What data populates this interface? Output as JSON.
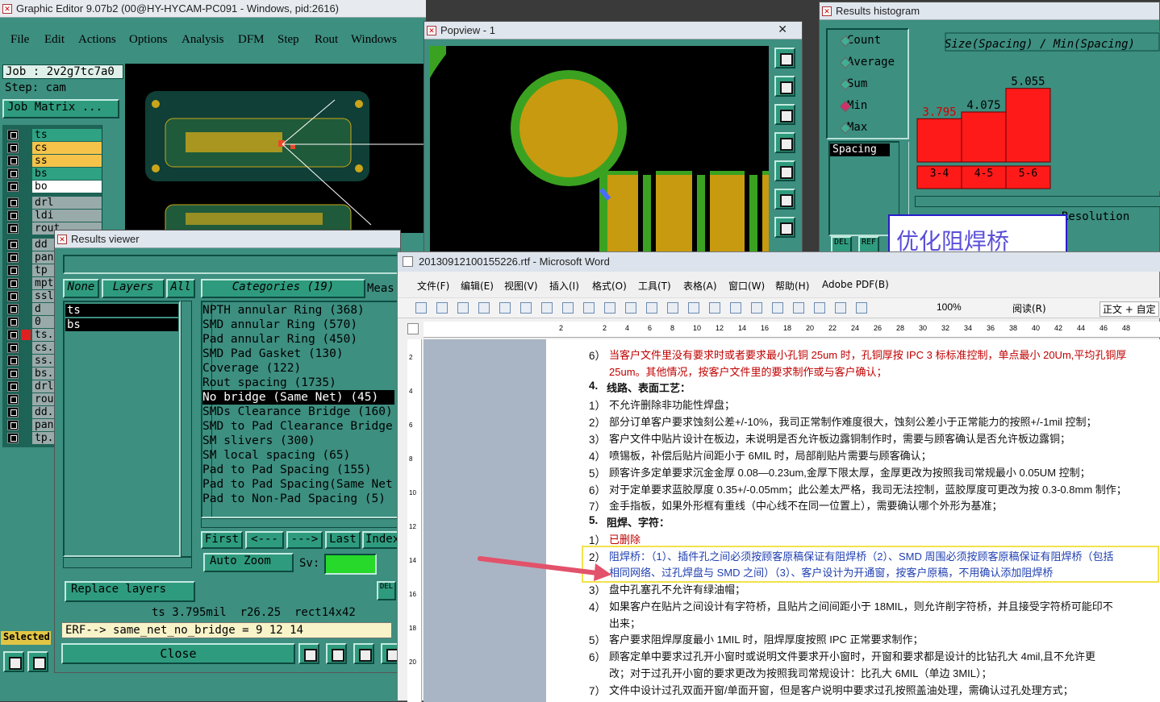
{
  "editor": {
    "title": "Graphic Editor 9.07b2 (00@HY-HYCAM-PC091 - Windows, pid:2616)",
    "menu": [
      "File",
      "Edit",
      "Actions",
      "Options",
      "Analysis",
      "DFM",
      "Step",
      "Rout",
      "Windows"
    ],
    "menu_tail": "p",
    "job": "Job : 2v2g7tc7a0",
    "step": "Step: cam",
    "job_matrix": "Job Matrix ...",
    "layers": [
      {
        "name": "ts",
        "color": "#2fa283"
      },
      {
        "name": "cs",
        "color": "#f5c34a"
      },
      {
        "name": "ss",
        "color": "#f5c34a"
      },
      {
        "name": "bs",
        "color": "#2fa283"
      },
      {
        "name": "bo",
        "color": "#ffffff"
      },
      {
        "name": "drl",
        "color": "#9aa"
      },
      {
        "name": "ldi",
        "color": "#9aa"
      },
      {
        "name": "rout",
        "color": "#9aa"
      },
      {
        "name": "dd",
        "color": "#9aa"
      },
      {
        "name": "pane",
        "color": "#9aa"
      },
      {
        "name": "tp",
        "color": "#9aa"
      },
      {
        "name": "mpth",
        "color": "#9aa"
      },
      {
        "name": "ssls",
        "color": "#9aa"
      },
      {
        "name": "d",
        "color": "#9aa"
      },
      {
        "name": "0",
        "color": "#9aa"
      },
      {
        "name": "ts.c",
        "color": "#9aa"
      },
      {
        "name": "cs.c",
        "color": "#9aa"
      },
      {
        "name": "ss.c",
        "color": "#9aa"
      },
      {
        "name": "bs.c",
        "color": "#9aa"
      },
      {
        "name": "drl.",
        "color": "#9aa"
      },
      {
        "name": "rout",
        "color": "#9aa"
      },
      {
        "name": "dd.c",
        "color": "#9aa"
      },
      {
        "name": "pane",
        "color": "#9aa"
      },
      {
        "name": "tp.c",
        "color": "#9aa"
      }
    ],
    "selected_label": "Selected"
  },
  "popview": {
    "title": "Popview - 1"
  },
  "histogram": {
    "title": "Results histogram",
    "options": [
      {
        "label": "Count",
        "selected": false
      },
      {
        "label": "Average",
        "selected": false
      },
      {
        "label": "Sum",
        "selected": false
      },
      {
        "label": "Min",
        "selected": true
      },
      {
        "label": "Max",
        "selected": false
      }
    ],
    "metric": "Spacing",
    "chart_title": "Size(Spacing) / Min(Spacing)",
    "resolution_label": "Resolution",
    "del_label": "DEL",
    "ref_label": "REF"
  },
  "chart_data": {
    "type": "bar",
    "title": "Size(Spacing) / Min(Spacing)",
    "categories": [
      "3-4",
      "4-5",
      "5-6"
    ],
    "values": [
      3.795,
      4.075,
      5.055
    ],
    "data_labels": [
      "3.795",
      "4.075",
      "5.055"
    ]
  },
  "overlay_label": "优化阻焊桥",
  "results_viewer": {
    "title": "Results viewer",
    "none_label": "None",
    "layers_label": "Layers",
    "all_label": "All",
    "selected_layers": [
      "ts",
      "bs"
    ],
    "categories_header": "Categories (19)",
    "meas_label": "Meas",
    "categories": [
      "NPTH annular Ring (368)",
      "SMD annular Ring (570)",
      "Pad annular Ring (450)",
      "SMD Pad Gasket (130)",
      "Coverage (122)",
      "Rout spacing (1735)",
      "No bridge (Same Net) (45)",
      "SMDs Clearance Bridge (160)",
      "SMD to Pad Clearance Bridge",
      "SM slivers (300)",
      "SM local spacing (65)",
      "Pad to Pad Spacing (155)",
      "Pad to Pad Spacing(Same Net",
      "Pad to Non-Pad Spacing (5)"
    ],
    "selected_index": 6,
    "nav": [
      "First",
      "<---",
      "--->",
      "Last",
      "Index"
    ],
    "auto_zoom": "Auto Zoom",
    "sv_label": "Sv:",
    "replace_layers": "Replace layers",
    "del_label": "DEL",
    "status": "ts 3.795mil  r26.25  rect14x42",
    "erf": "ERF--> same_net_no_bridge = 9 12 14",
    "close": "Close"
  },
  "word": {
    "title": "20130912100155226.rtf - Microsoft Word",
    "menu": [
      "文件(F)",
      "编辑(E)",
      "视图(V)",
      "插入(I)",
      "格式(O)",
      "工具(T)",
      "表格(A)",
      "窗口(W)",
      "帮助(H)",
      "Adobe PDF(B)"
    ],
    "zoom": "100%",
    "read_mode": "阅读(R)",
    "style": "正文 + 自定",
    "ruler": [
      "2",
      "2",
      "4",
      "6",
      "8",
      "10",
      "12",
      "14",
      "16",
      "18",
      "20",
      "22",
      "24",
      "26",
      "28",
      "30",
      "32",
      "34",
      "36",
      "38",
      "40",
      "42",
      "44",
      "46",
      "48"
    ],
    "vruler": [
      "2",
      "4",
      "6",
      "8",
      "10",
      "12",
      "14",
      "16",
      "18",
      "20"
    ],
    "lines": [
      {
        "num": "6）",
        "text": "当客户文件里没有要求时或者要求最小孔铜 25um 时，孔铜厚按 IPC 3 标标准控制，单点最小 20Um,平均孔铜厚",
        "cls": "red"
      },
      {
        "num": "",
        "text": "25um。其他情况，按客户文件里的要求制作或与客户确认；",
        "cls": "red"
      },
      {
        "num": "4.",
        "text": "线路、表面工艺：",
        "cls": "bold"
      },
      {
        "num": "1）",
        "text": "不允许删除非功能性焊盘；",
        "cls": ""
      },
      {
        "num": "2）",
        "text": "部分订单客户要求蚀刻公差+/-10%，我司正常制作难度很大，蚀刻公差小于正常能力的按照+/-1mil 控制；",
        "cls": ""
      },
      {
        "num": "3）",
        "text": "客户文件中贴片设计在板边，未说明是否允许板边露铜制作时，需要与顾客确认是否允许板边露铜；",
        "cls": ""
      },
      {
        "num": "4）",
        "text": "喷锡板，补偿后贴片间距小于 6MIL 时，局部削贴片需要与顾客确认；",
        "cls": ""
      },
      {
        "num": "5）",
        "text": "顾客许多定单要求沉金金厚 0.08—0.23um,金厚下限太厚，金厚更改为按照我司常规最小 0.05UM 控制；",
        "cls": ""
      },
      {
        "num": "6）",
        "text": "对于定单要求蓝胶厚度 0.35+/-0.05mm；此公差太严格，我司无法控制，蓝胶厚度可更改为按 0.3-0.8mm 制作；",
        "cls": ""
      },
      {
        "num": "7）",
        "text": "金手指板，如果外形框有重线（中心线不在同一位置上），需要确认哪个外形为基准；",
        "cls": ""
      },
      {
        "num": "5.",
        "text": "阻焊、字符：",
        "cls": "bold"
      },
      {
        "num": "1）",
        "text": "已删除",
        "cls": "red"
      },
      {
        "num": "2）",
        "text": "阻焊桥：（1）、插件孔之间必须按顾客原稿保证有阻焊桥（2）、SMD 周围必须按顾客原稿保证有阻焊桥（包括",
        "cls": "blue"
      },
      {
        "num": "",
        "text": "相同网络、过孔焊盘与 SMD 之间）（3）、客户设计为开通窗，按客户原稿，不用确认添加阻焊桥",
        "cls": "blue"
      },
      {
        "num": "3）",
        "text": "盘中孔塞孔不允许有绿油帽；",
        "cls": ""
      },
      {
        "num": "4）",
        "text": "如果客户在贴片之间设计有字符桥，且贴片之间间距小于 18MIL，则允许削字符桥，并且接受字符桥可能印不",
        "cls": ""
      },
      {
        "num": "",
        "text": "出来；",
        "cls": ""
      },
      {
        "num": "5）",
        "text": "客户要求阻焊厚度最小 1MIL 时，阻焊厚度按照 IPC 正常要求制作；",
        "cls": ""
      },
      {
        "num": "6）",
        "text": "顾客定单中要求过孔开小窗时或说明文件要求开小窗时，开窗和要求都是设计的比钻孔大 4mil,且不允许更",
        "cls": ""
      },
      {
        "num": "",
        "text": "改；对于过孔开小窗的要求更改为按照我司常规设计：比孔大 6MIL（单边 3MIL）；",
        "cls": ""
      },
      {
        "num": "7）",
        "text": "文件中设计过孔双面开窗/单面开窗，但是客户说明中要求过孔按照盖油处理，需确认过孔处理方式；",
        "cls": ""
      }
    ]
  }
}
